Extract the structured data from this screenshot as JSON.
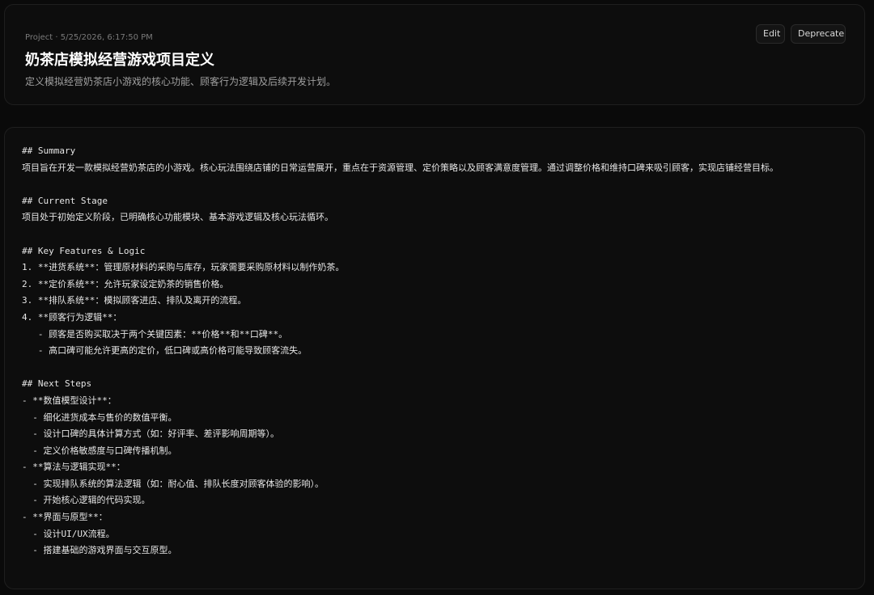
{
  "header": {
    "meta": "Project · 5/25/2026, 6:17:50 PM",
    "title": "奶茶店模拟经营游戏项目定义",
    "subtitle": "定义模拟经营奶茶店小游戏的核心功能、顾客行为逻辑及后续开发计划。",
    "actions": {
      "edit_label": "Edit",
      "deprecate_label": "Deprecate"
    }
  },
  "document": {
    "content": "## Summary\n项目旨在开发一款模拟经营奶茶店的小游戏。核心玩法围绕店铺的日常运营展开，重点在于资源管理、定价策略以及顾客满意度管理。通过调整价格和维持口碑来吸引顾客，实现店铺经营目标。\n\n## Current Stage\n项目处于初始定义阶段，已明确核心功能模块、基本游戏逻辑及核心玩法循环。\n\n## Key Features & Logic\n1. **进货系统**：管理原材料的采购与库存，玩家需要采购原材料以制作奶茶。\n2. **定价系统**：允许玩家设定奶茶的销售价格。\n3. **排队系统**：模拟顾客进店、排队及离开的流程。\n4. **顾客行为逻辑**：\n   - 顾客是否购买取决于两个关键因素：**价格**和**口碑**。\n   - 高口碑可能允许更高的定价，低口碑或高价格可能导致顾客流失。\n\n## Next Steps\n- **数值模型设计**：\n  - 细化进货成本与售价的数值平衡。\n  - 设计口碑的具体计算方式（如：好评率、差评影响周期等）。\n  - 定义价格敏感度与口碑传播机制。\n- **算法与逻辑实现**：\n  - 实现排队系统的算法逻辑（如：耐心值、排队长度对顾客体验的影响）。\n  - 开始核心逻辑的代码实现。\n- **界面与原型**：\n  - 设计UI/UX流程。\n  - 搭建基础的游戏界面与交互原型。"
  }
}
